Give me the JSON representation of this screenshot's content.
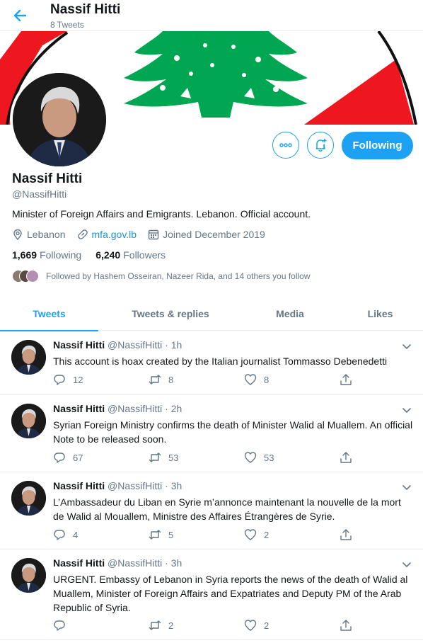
{
  "header": {
    "title": "Nassif Hitti",
    "subtitle": "8 Tweets"
  },
  "profile": {
    "name": "Nassif Hitti",
    "handle": "@NassifHitti",
    "bio": "Minister of Foreign Affairs and Emigrants. Lebanon. Official account.",
    "location": "Lebanon",
    "website": "mfa.gov.lb",
    "joined": "Joined December 2019",
    "following_count": "1,669",
    "following_label": "Following",
    "followers_count": "6,240",
    "followers_label": "Followers",
    "followed_by": "Followed by Hashem Osseiran, Nazeer Rida, and 14 others you follow",
    "follow_button": "Following"
  },
  "tabs": [
    {
      "label": "Tweets",
      "active": true
    },
    {
      "label": "Tweets & replies",
      "active": false
    },
    {
      "label": "Media",
      "active": false
    },
    {
      "label": "Likes",
      "active": false
    }
  ],
  "tweets": [
    {
      "name": "Nassif Hitti",
      "handle": "@NassifHitti",
      "time": "1h",
      "text": "This account is hoax created by  the Italian journalist Tommasso Debenedetti",
      "replies": "12",
      "retweets": "8",
      "likes": "8"
    },
    {
      "name": "Nassif Hitti",
      "handle": "@NassifHitti",
      "time": "2h",
      "text": "Syrian Foreign Ministry confirms the death of Minister Walid al Muallem. An official Note to be released soon.",
      "replies": "67",
      "retweets": "53",
      "likes": "53"
    },
    {
      "name": "Nassif Hitti",
      "handle": "@NassifHitti",
      "time": "3h",
      "text": "L’Ambassadeur du Liban en Syrie m’annonce maintenant la nouvelle de la mort de Walid al Mouallem, Ministre des Affaires Étrangères de Syrie.",
      "replies": "4",
      "retweets": "5",
      "likes": "2"
    },
    {
      "name": "Nassif Hitti",
      "handle": "@NassifHitti",
      "time": "3h",
      "text": "URGENT. Embassy of Lebanon in Syria reports the news of the death of Walid al Muallem, Minister of Foreign Affairs and Expatriates and Deputy PM of the Arab Republic of Syria.",
      "replies": "",
      "retweets": "2",
      "likes": "2"
    }
  ],
  "colors": {
    "accent": "#1da1f2",
    "flag_red": "#ee161f",
    "cedar_green": "#00a651",
    "muted": "#657786"
  }
}
